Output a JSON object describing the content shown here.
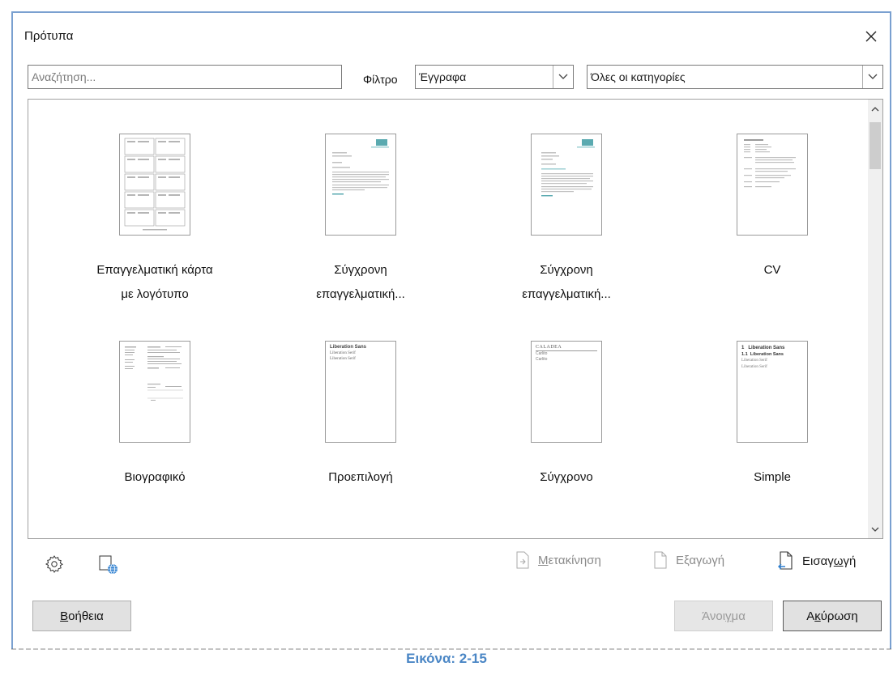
{
  "dialog": {
    "title": "Πρότυπα",
    "search": {
      "placeholder": "Αναζήτηση...",
      "value": ""
    },
    "filter_label": "Φίλτρο",
    "filter_type": {
      "selected": "Έγγραφα"
    },
    "filter_category": {
      "selected": "Όλες οι κατηγορίες"
    }
  },
  "templates": [
    {
      "line1": "Επαγγελματική κάρτα",
      "line2": "με λογότυπο"
    },
    {
      "line1": "Σύγχρονη",
      "line2": "επαγγελματική..."
    },
    {
      "line1": "Σύγχρονη",
      "line2": "επαγγελματική..."
    },
    {
      "line1": "CV",
      "line2": ""
    },
    {
      "line1": "Βιογραφικό",
      "line2": ""
    },
    {
      "line1": "Προεπιλογή",
      "line2": ""
    },
    {
      "line1": "Σύγχρονο",
      "line2": ""
    },
    {
      "line1": "Simple",
      "line2": ""
    }
  ],
  "thumb_text": {
    "t6_title": "Liberation Sans",
    "t6_line1": "Liberation Serif",
    "t6_line2": "Liberation Serif",
    "t7_title": "CALADEA",
    "t7_line1": "Carlito",
    "t7_line2": "Carlito",
    "t8_h1_num": "1",
    "t8_h1": "Liberation Sans",
    "t8_h2_num": "1.1",
    "t8_h2": "Liberation Sans",
    "t8_line1": "Liberation Serif",
    "t8_line2": "Liberation Serif"
  },
  "actions": {
    "move": {
      "pre": "",
      "mn": "Μ",
      "post": "ετακίνηση"
    },
    "export": {
      "label": "Εξαγωγή"
    },
    "import": {
      "pre": "Εισαγ",
      "mn": "ω",
      "post": "γή"
    }
  },
  "buttons": {
    "help": {
      "pre": "",
      "mn": "Β",
      "post": "οήθεια"
    },
    "open": {
      "pre": "Άνοι",
      "mn": "γ",
      "post": "μα"
    },
    "cancel": {
      "pre": "Α",
      "mn": "κ",
      "post": "ύρωση"
    }
  },
  "caption": "Εικόνα: 2-15",
  "colors": {
    "accent": "#4a86c5",
    "window_border": "#7aa0d0",
    "thumb_teal": "#5aaab0"
  }
}
